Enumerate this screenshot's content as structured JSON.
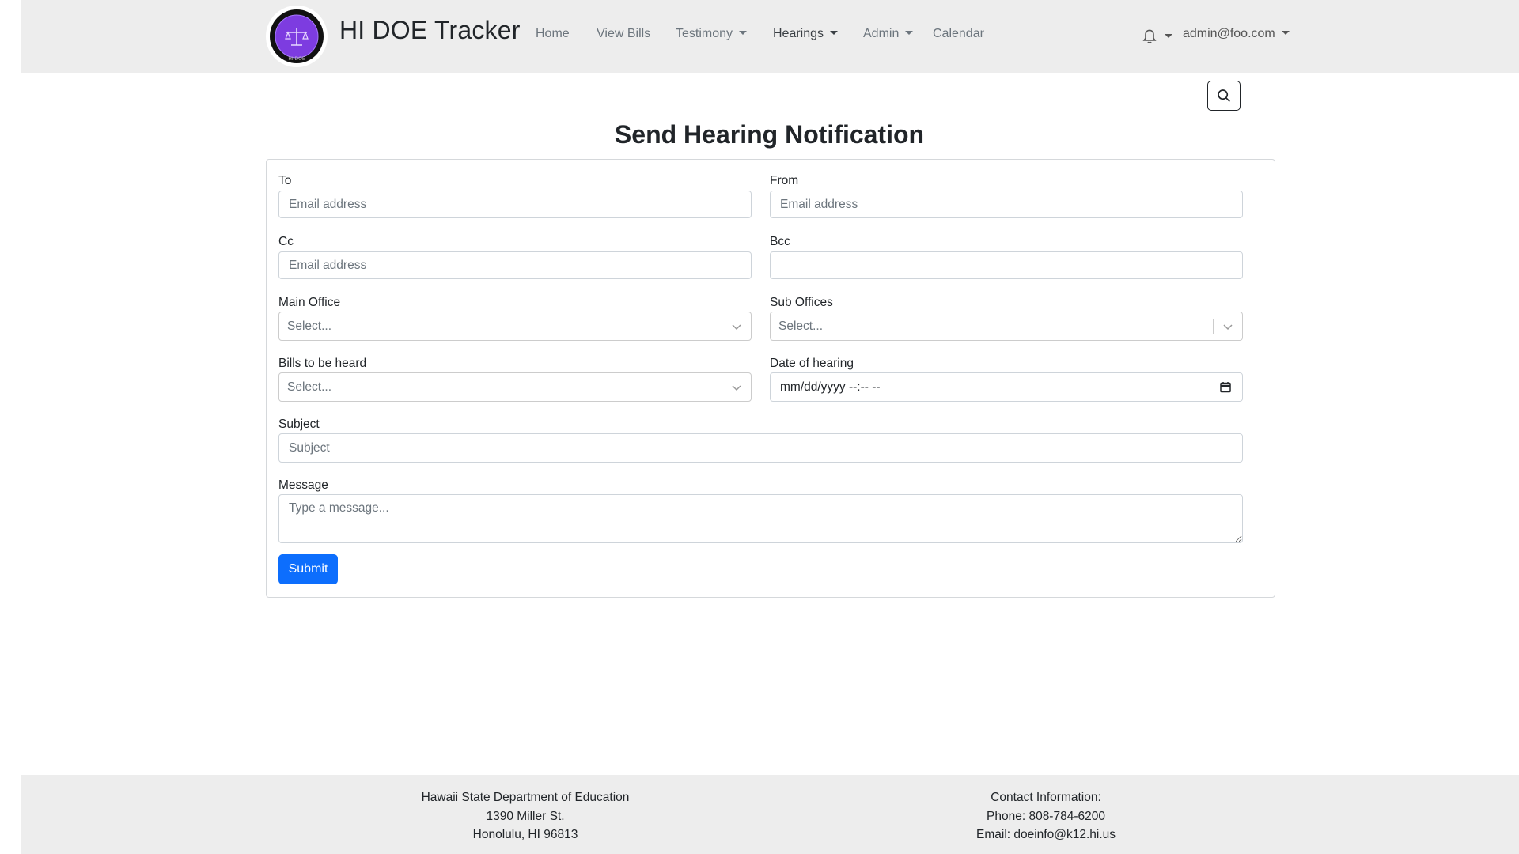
{
  "nav": {
    "brand": "HI DOE Tracker",
    "logo_text": "HI DOE",
    "items": [
      {
        "label": "Home"
      },
      {
        "label": "View Bills"
      },
      {
        "label": "Testimony"
      },
      {
        "label": "Hearings"
      },
      {
        "label": "Admin"
      },
      {
        "label": "Calendar"
      }
    ],
    "user_email": "admin@foo.com",
    "logo_color": "#7d3ce0"
  },
  "page": {
    "title": "Send Hearing Notification"
  },
  "form": {
    "to": {
      "label": "To",
      "placeholder": "Email address",
      "value": ""
    },
    "from": {
      "label": "From",
      "placeholder": "Email address",
      "value": ""
    },
    "cc": {
      "label": "Cc",
      "placeholder": "Email address",
      "value": ""
    },
    "bcc": {
      "label": "Bcc",
      "placeholder": "",
      "value": ""
    },
    "main_office": {
      "label": "Main Office",
      "placeholder": "Select..."
    },
    "sub_offices": {
      "label": "Sub Offices",
      "placeholder": "Select..."
    },
    "bills": {
      "label": "Bills to be heard",
      "placeholder": "Select..."
    },
    "date": {
      "label": "Date of hearing",
      "display": "mm/dd/yyyy --:-- --"
    },
    "subject": {
      "label": "Subject",
      "placeholder": "Subject",
      "value": ""
    },
    "message": {
      "label": "Message",
      "placeholder": "Type a message...",
      "value": ""
    },
    "submit_label": "Submit"
  },
  "footer": {
    "org": "Hawaii State Department of Education",
    "address1": "1390 Miller St.",
    "address2": "Honolulu, HI 96813",
    "contact_heading": "Contact Information:",
    "phone": "Phone: 808-784-6200",
    "email": "Email: doeinfo@k12.hi.us"
  },
  "colors": {
    "primary": "#0d6efd",
    "navbar_bg": "#ededed",
    "footer_bg": "#ededed"
  },
  "icons": [
    "bell-icon",
    "search-icon",
    "calendar-icon",
    "chevron-down-icon"
  ]
}
